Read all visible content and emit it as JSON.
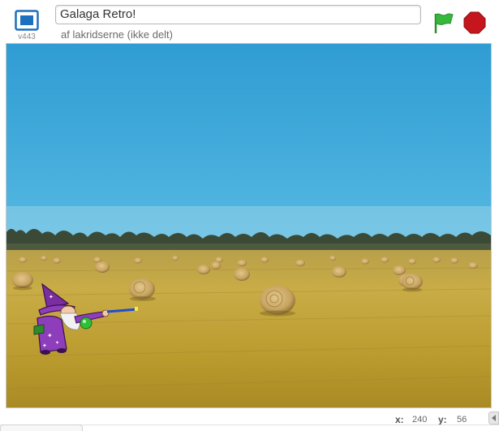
{
  "player": {
    "version": "v443",
    "project_title": "Galaga Retro!",
    "author_line": "af lakridserne (ikke delt)",
    "fullscreen_icon": "fullscreen-icon",
    "green_flag_icon": "green-flag-icon",
    "stop_icon": "stop-sign-icon"
  },
  "stage": {
    "backdrop": "hay-bale-field",
    "sprite": "wizard-with-wand"
  },
  "mouse_readout": {
    "x_label": "x:",
    "x_value": "240",
    "y_label": "y:",
    "y_value": "56"
  },
  "colors": {
    "accent_blue": "#1d6fbf",
    "flag_green": "#35b83b",
    "stop_red": "#c4161c"
  }
}
